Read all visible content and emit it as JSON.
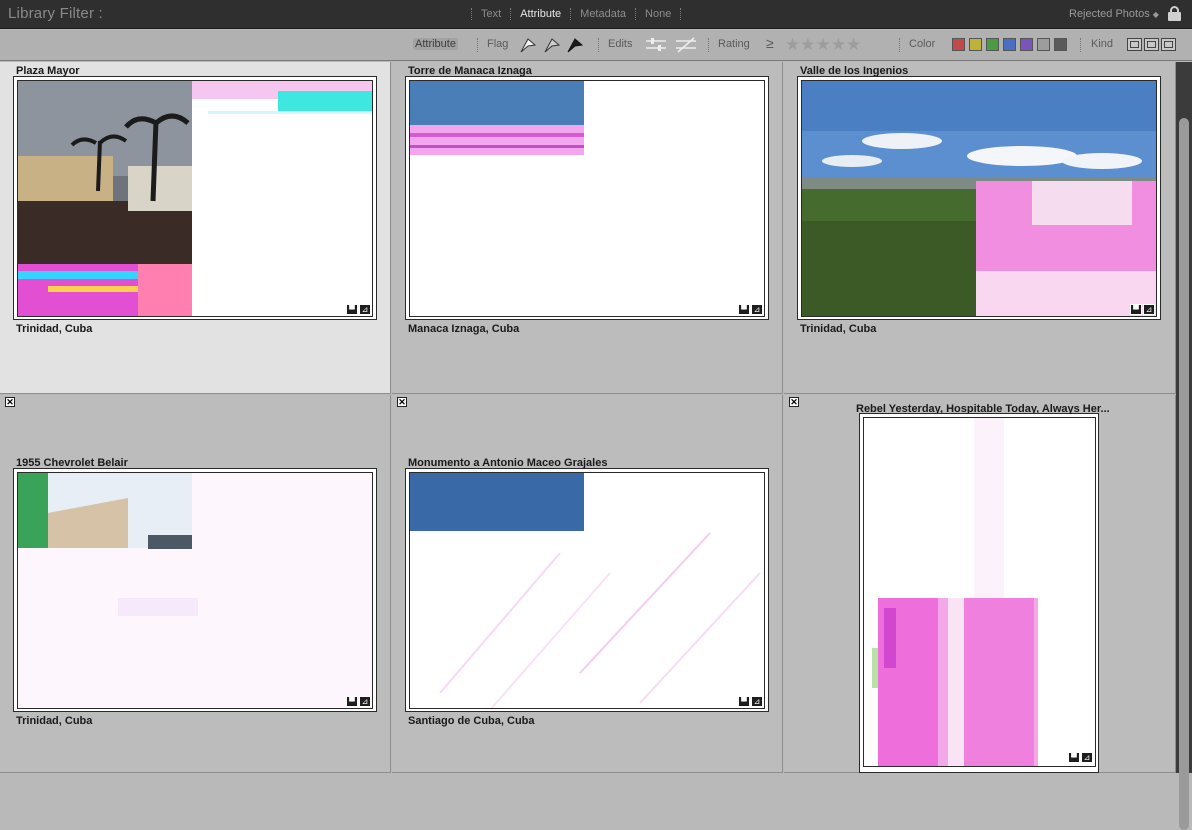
{
  "filter_bar": {
    "title": "Library Filter :",
    "modes": [
      {
        "label": "Text",
        "active": false
      },
      {
        "label": "Attribute",
        "active": true
      },
      {
        "label": "Metadata",
        "active": false
      },
      {
        "label": "None",
        "active": false
      }
    ],
    "preset": "Rejected Photos",
    "lock_icon": "lock-icon"
  },
  "attribute_bar": {
    "section_label": "Attribute",
    "flag_label": "Flag",
    "edits_label": "Edits",
    "rating_label": "Rating",
    "rating_operator": "≥",
    "rating_stars": "★★★★★",
    "color_label": "Color",
    "colors": [
      "#c24a4a",
      "#bdb23c",
      "#4d9a45",
      "#4b6fc0",
      "#7a55b8",
      "#9d9d9d",
      "#5a5a5a"
    ],
    "kind_label": "Kind"
  },
  "grid": {
    "cells": [
      {
        "title": "Plaza Mayor",
        "subtitle": "Trinidad, Cuba",
        "selected": true,
        "rejected": false
      },
      {
        "title": "Torre de Manaca Iznaga",
        "subtitle": "Manaca Iznaga, Cuba",
        "selected": false,
        "rejected": false
      },
      {
        "title": "Valle de los Ingenios",
        "subtitle": "Trinidad, Cuba",
        "selected": false,
        "rejected": false
      },
      {
        "title": "1955 Chevrolet Belair",
        "subtitle": "Trinidad, Cuba",
        "selected": false,
        "rejected": true
      },
      {
        "title": "Monumento a Antonio Maceo Grajales",
        "subtitle": "Santiago de Cuba, Cuba",
        "selected": false,
        "rejected": true
      },
      {
        "title": "Rebel Yesterday, Hospitable Today, Always Her...",
        "subtitle": "",
        "selected": false,
        "rejected": true
      }
    ],
    "badge_icons": [
      "comment-icon",
      "edit-adjust-icon"
    ],
    "reject_mark": "✕"
  }
}
